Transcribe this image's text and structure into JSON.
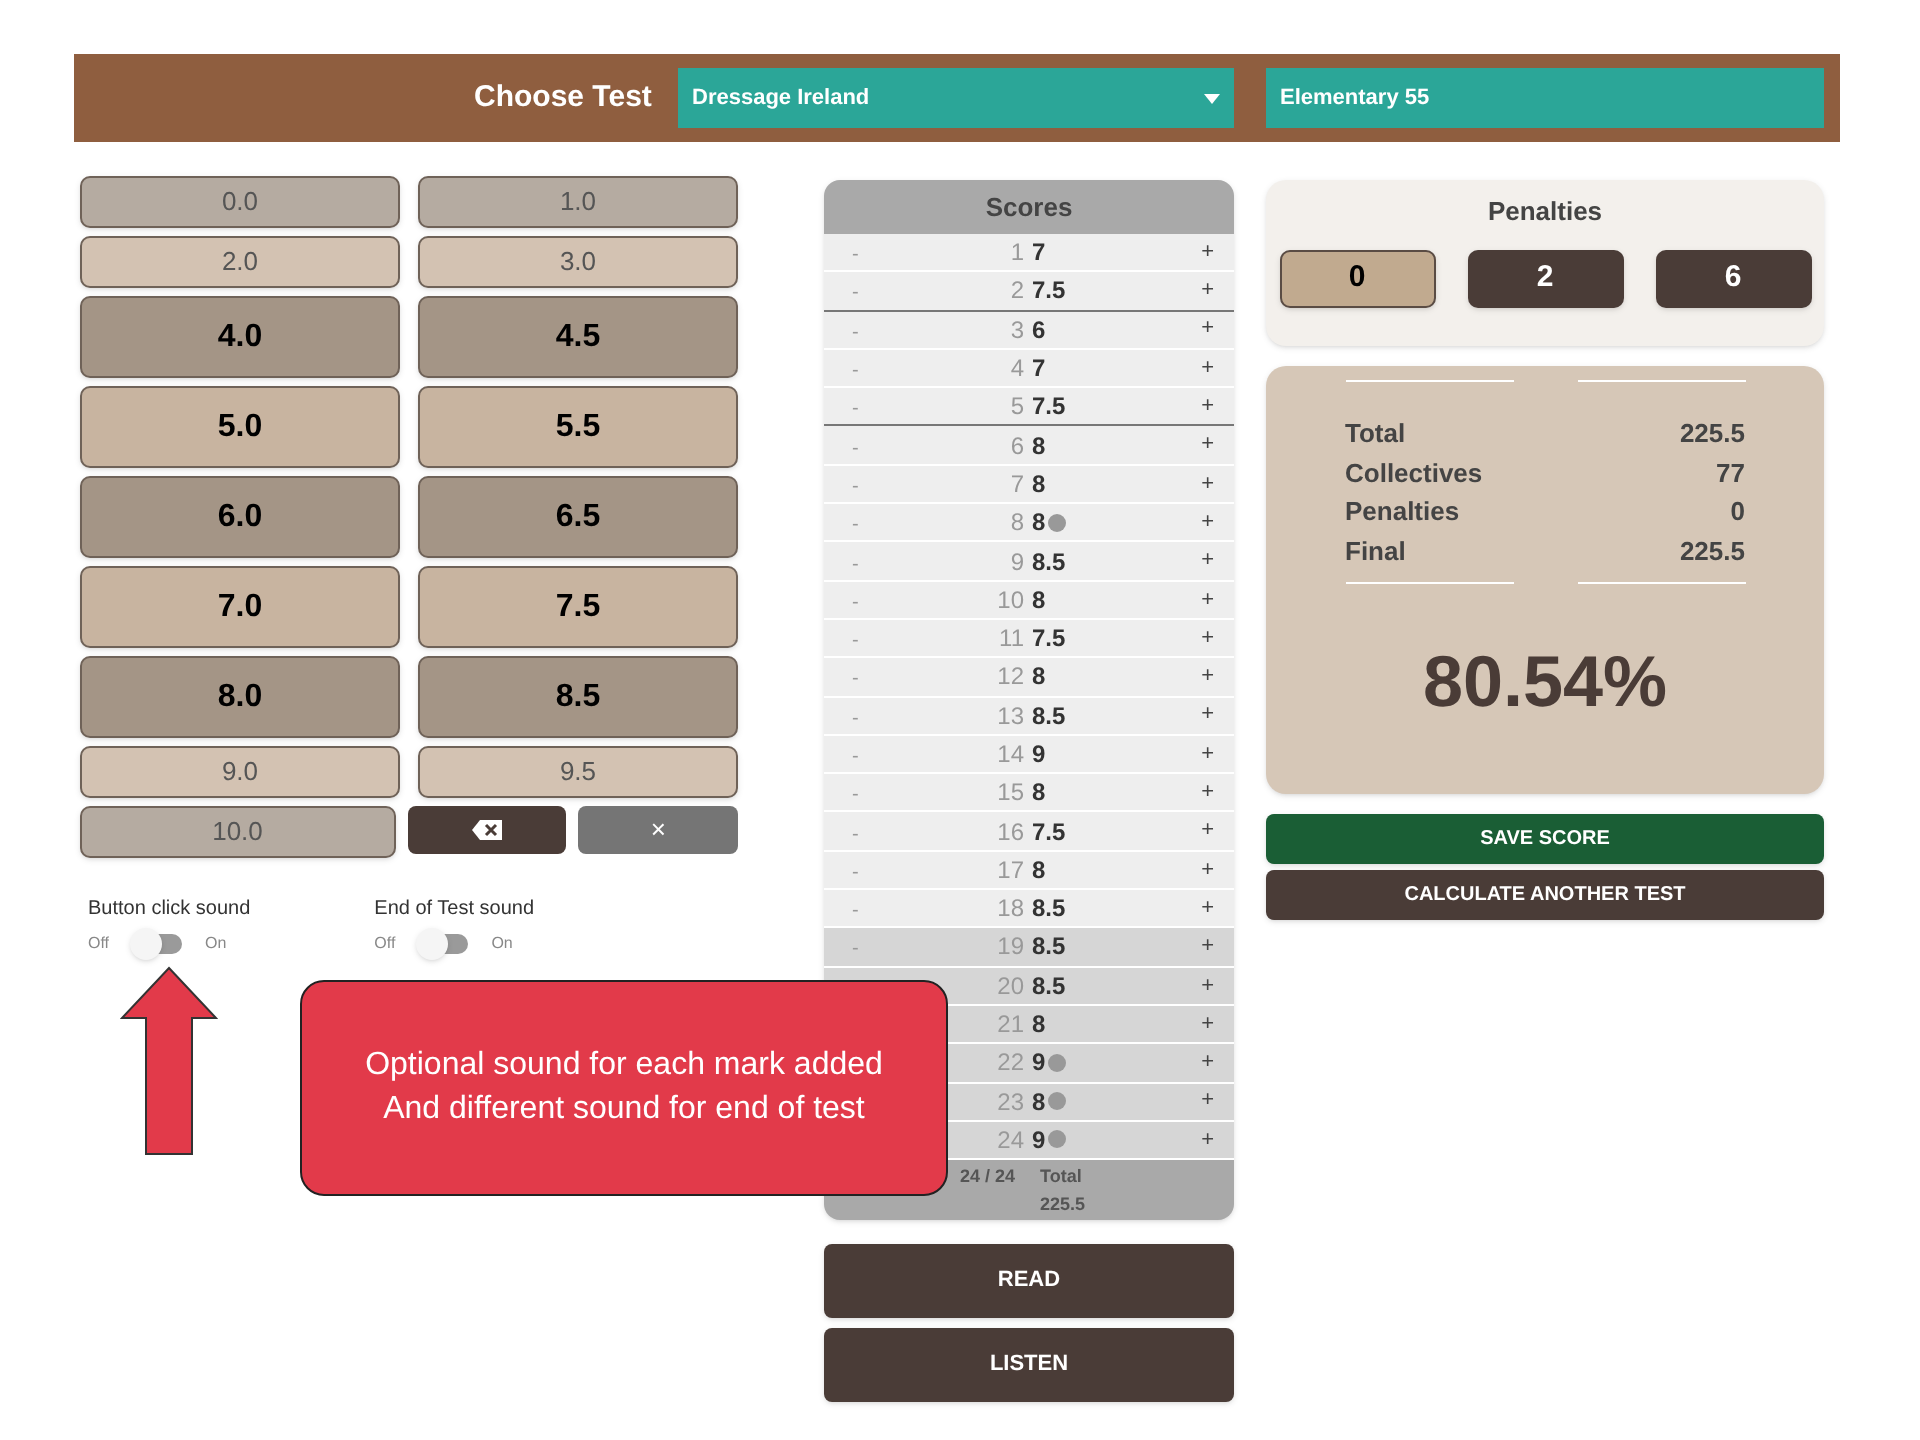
{
  "header": {
    "title": "Choose Test",
    "organisation": "Dressage Ireland",
    "test": "Elementary 55"
  },
  "mark_buttons": [
    {
      "label": "0.0",
      "kind": "small",
      "color": "#b5aba1"
    },
    {
      "label": "1.0",
      "kind": "small",
      "color": "#b5aba1"
    },
    {
      "label": "2.0",
      "kind": "small",
      "color": "#d3c2b2"
    },
    {
      "label": "3.0",
      "kind": "small",
      "color": "#d3c2b2"
    },
    {
      "label": "4.0",
      "kind": "large",
      "color": "#a49586"
    },
    {
      "label": "4.5",
      "kind": "large",
      "color": "#a49586"
    },
    {
      "label": "5.0",
      "kind": "large",
      "color": "#c8b4a0"
    },
    {
      "label": "5.5",
      "kind": "large",
      "color": "#c8b4a0"
    },
    {
      "label": "6.0",
      "kind": "large",
      "color": "#a49586"
    },
    {
      "label": "6.5",
      "kind": "large",
      "color": "#a49586"
    },
    {
      "label": "7.0",
      "kind": "large",
      "color": "#c8b4a0"
    },
    {
      "label": "7.5",
      "kind": "large",
      "color": "#c8b4a0"
    },
    {
      "label": "8.0",
      "kind": "large",
      "color": "#a49586"
    },
    {
      "label": "8.5",
      "kind": "large",
      "color": "#a49586"
    },
    {
      "label": "9.0",
      "kind": "small",
      "color": "#d3c2b2"
    },
    {
      "label": "9.5",
      "kind": "small",
      "color": "#d3c2b2"
    },
    {
      "label": "10.0",
      "kind": "small",
      "color": "#b5aba1"
    }
  ],
  "clear_button": {
    "label": "×"
  },
  "sounds": [
    {
      "label": "Button click sound",
      "off": "Off",
      "on_label": "On",
      "on": false
    },
    {
      "label": "End of Test sound",
      "off": "Off",
      "on_label": "On",
      "on": false
    }
  ],
  "scores": {
    "title": "Scores",
    "rows": [
      {
        "minus": "-",
        "number": "1",
        "value": "7",
        "plus": "+",
        "highlighted": false,
        "note": false,
        "section_break": false
      },
      {
        "minus": "-",
        "number": "2",
        "value": "7.5",
        "plus": "+",
        "highlighted": false,
        "note": false,
        "section_break": true
      },
      {
        "minus": "-",
        "number": "3",
        "value": "6",
        "plus": "+",
        "highlighted": false,
        "note": false,
        "section_break": false
      },
      {
        "minus": "-",
        "number": "4",
        "value": "7",
        "plus": "+",
        "highlighted": false,
        "note": false,
        "section_break": false
      },
      {
        "minus": "-",
        "number": "5",
        "value": "7.5",
        "plus": "+",
        "highlighted": false,
        "note": false,
        "section_break": true
      },
      {
        "minus": "-",
        "number": "6",
        "value": "8",
        "plus": "+",
        "highlighted": false,
        "note": false,
        "section_break": false
      },
      {
        "minus": "-",
        "number": "7",
        "value": "8",
        "plus": "+",
        "highlighted": false,
        "note": false,
        "section_break": false
      },
      {
        "minus": "-",
        "number": "8",
        "value": "8",
        "plus": "+",
        "highlighted": false,
        "note": true,
        "section_break": false
      },
      {
        "minus": "-",
        "number": "9",
        "value": "8.5",
        "plus": "+",
        "highlighted": false,
        "note": false,
        "section_break": false
      },
      {
        "minus": "-",
        "number": "10",
        "value": "8",
        "plus": "+",
        "highlighted": false,
        "note": false,
        "section_break": false
      },
      {
        "minus": "-",
        "number": "11",
        "value": "7.5",
        "plus": "+",
        "highlighted": false,
        "note": false,
        "section_break": false
      },
      {
        "minus": "-",
        "number": "12",
        "value": "8",
        "plus": "+",
        "highlighted": false,
        "note": false,
        "section_break": false
      },
      {
        "minus": "-",
        "number": "13",
        "value": "8.5",
        "plus": "+",
        "highlighted": false,
        "note": false,
        "section_break": false
      },
      {
        "minus": "-",
        "number": "14",
        "value": "9",
        "plus": "+",
        "highlighted": false,
        "note": false,
        "section_break": false
      },
      {
        "minus": "-",
        "number": "15",
        "value": "8",
        "plus": "+",
        "highlighted": false,
        "note": false,
        "section_break": false
      },
      {
        "minus": "-",
        "number": "16",
        "value": "7.5",
        "plus": "+",
        "highlighted": false,
        "note": false,
        "section_break": false
      },
      {
        "minus": "-",
        "number": "17",
        "value": "8",
        "plus": "+",
        "highlighted": false,
        "note": false,
        "section_break": false
      },
      {
        "minus": "-",
        "number": "18",
        "value": "8.5",
        "plus": "+",
        "highlighted": false,
        "note": false,
        "section_break": false
      },
      {
        "minus": "-",
        "number": "19",
        "value": "8.5",
        "plus": "+",
        "highlighted": true,
        "note": false,
        "section_break": false
      },
      {
        "number": "20",
        "value": "8.5",
        "plus": "+",
        "highlighted": true,
        "note": false,
        "section_break": false
      },
      {
        "number": "21",
        "value": "8",
        "plus": "+",
        "highlighted": true,
        "note": false,
        "section_break": false
      },
      {
        "number": "22",
        "value": "9",
        "plus": "+",
        "highlighted": true,
        "note": true,
        "section_break": false
      },
      {
        "number": "23",
        "value": "8",
        "plus": "+",
        "highlighted": true,
        "note": true,
        "section_break": false
      },
      {
        "number": "24",
        "value": "9",
        "plus": "+",
        "highlighted": true,
        "note": true,
        "section_break": false
      }
    ],
    "count": "24 / 24",
    "total_label": "Total",
    "total": "225.5"
  },
  "actions_left": [
    "READ",
    "LISTEN"
  ],
  "penalties": {
    "title": "Penalties",
    "options": [
      {
        "label": "0",
        "selected": true
      },
      {
        "label": "2",
        "selected": false
      },
      {
        "label": "6",
        "selected": false
      }
    ]
  },
  "summary": {
    "lines": [
      {
        "label": "Total",
        "value": "225.5"
      },
      {
        "label": "Collectives",
        "value": "77"
      },
      {
        "label": "Penalties",
        "value": "0"
      },
      {
        "label": "Final",
        "value": "225.5"
      }
    ],
    "percentage": "80.54%"
  },
  "actions_right": [
    {
      "label": "SAVE SCORE",
      "kind": "primary"
    },
    {
      "label": "CALCULATE ANOTHER TEST",
      "kind": "secondary"
    }
  ],
  "annotation": {
    "lines": [
      "Optional sound for each mark added",
      "And different sound for end of test"
    ]
  }
}
